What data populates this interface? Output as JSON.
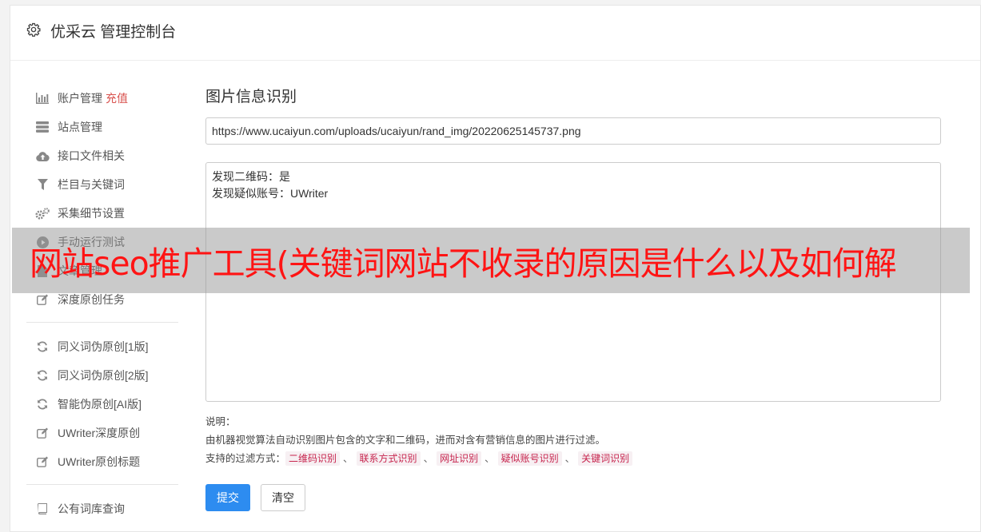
{
  "header": {
    "title": "优采云 管理控制台",
    "icon": "gear-icon"
  },
  "sidebar": {
    "groups": [
      [
        {
          "label": "账户管理",
          "accent": "充值",
          "icon": "bar-chart-icon"
        },
        {
          "label": "站点管理",
          "icon": "server-icon"
        },
        {
          "label": "接口文件相关",
          "icon": "cloud-upload-icon"
        },
        {
          "label": "栏目与关键词",
          "icon": "filter-icon"
        },
        {
          "label": "采集细节设置",
          "icon": "cogs-icon"
        },
        {
          "label": "手动运行测试",
          "icon": "play-circle-icon"
        },
        {
          "label": "文章管理",
          "icon": "file-icon"
        },
        {
          "label": "深度原创任务",
          "icon": "edit-icon"
        }
      ],
      [
        {
          "label": "同义词伪原创[1版]",
          "icon": "refresh-icon"
        },
        {
          "label": "同义词伪原创[2版]",
          "icon": "refresh-icon"
        },
        {
          "label": "智能伪原创[AI版]",
          "icon": "refresh-icon"
        },
        {
          "label": "UWriter深度原创",
          "icon": "edit-icon"
        },
        {
          "label": "UWriter原创标题",
          "icon": "edit-icon"
        }
      ],
      [
        {
          "label": "公有词库查询",
          "icon": "book-icon"
        }
      ]
    ]
  },
  "main": {
    "heading": "图片信息识别",
    "url_value": "https://www.ucaiyun.com/uploads/ucaiyun/rand_img/20220625145737.png",
    "result_lines": [
      "发现二维码：是",
      "发现疑似账号：UWriter"
    ],
    "notes": {
      "title": "说明：",
      "description": "由机器视觉算法自动识别图片包含的文字和二维码，进而对含有营销信息的图片进行过滤。",
      "filter_label": "支持的过滤方式：",
      "separator": "、",
      "filters": [
        "二维码识别",
        "联系方式识别",
        "网址识别",
        "疑似账号识别",
        "关键词识别"
      ]
    },
    "submit_label": "提交",
    "clear_label": "清空"
  },
  "overlay": {
    "text": "网站seo推广工具(关键词网站不收录的原因是什么以及如何解"
  },
  "colors": {
    "primary": "#2d8cf0",
    "accent": "#d9534f",
    "tag_text": "#c7254e",
    "tag_bg": "#f7f0f3",
    "overlay_text": "#ff1414"
  }
}
